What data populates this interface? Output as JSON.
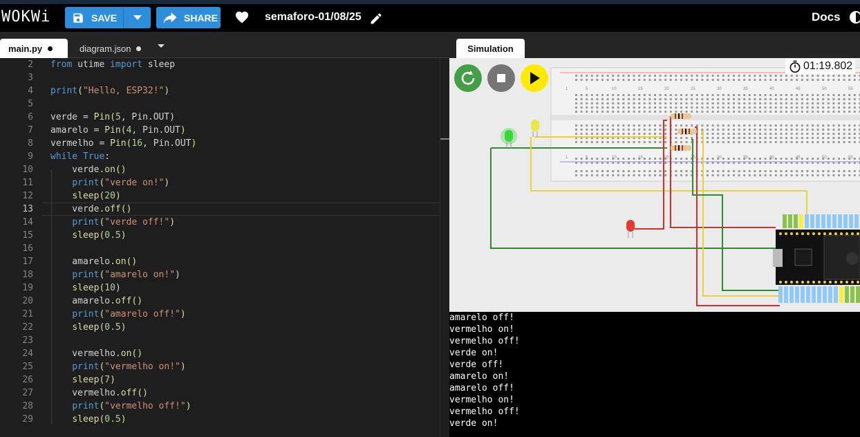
{
  "header": {
    "logo": "WOKWi",
    "save_label": "SAVE",
    "share_label": "SHARE",
    "project_name": "semaforo-01/08/25",
    "docs_label": "Docs"
  },
  "editor": {
    "tabs": [
      {
        "label": "main.py",
        "active": true
      },
      {
        "label": "diagram.json",
        "active": false
      }
    ],
    "current_line": 13,
    "lines": [
      {
        "n": "2",
        "text": "from utime import sleep"
      },
      {
        "n": "3",
        "text": ""
      },
      {
        "n": "4",
        "text": "print(\"Hello, ESP32!\")"
      },
      {
        "n": "5",
        "text": ""
      },
      {
        "n": "6",
        "text": "verde = Pin(5, Pin.OUT)"
      },
      {
        "n": "7",
        "text": "amarelo = Pin(4, Pin.OUT)"
      },
      {
        "n": "8",
        "text": "vermelho = Pin(16, Pin.OUT)"
      },
      {
        "n": "9",
        "text": "while True:"
      },
      {
        "n": "10",
        "text": "    verde.on()"
      },
      {
        "n": "11",
        "text": "    print(\"verde on!\")"
      },
      {
        "n": "12",
        "text": "    sleep(20)"
      },
      {
        "n": "13",
        "text": "    verde.off()"
      },
      {
        "n": "14",
        "text": "    print(\"verde off!\")"
      },
      {
        "n": "15",
        "text": "    sleep(0.5)"
      },
      {
        "n": "16",
        "text": ""
      },
      {
        "n": "17",
        "text": "    amarelo.on()"
      },
      {
        "n": "18",
        "text": "    print(\"amarelo on!\")"
      },
      {
        "n": "19",
        "text": "    sleep(10)"
      },
      {
        "n": "20",
        "text": "    amarelo.off()"
      },
      {
        "n": "21",
        "text": "    print(\"amarelo off!\")"
      },
      {
        "n": "22",
        "text": "    sleep(0.5)"
      },
      {
        "n": "23",
        "text": ""
      },
      {
        "n": "24",
        "text": "    vermelho.on()"
      },
      {
        "n": "25",
        "text": "    print(\"vermelho on!\")"
      },
      {
        "n": "26",
        "text": "    sleep(7)"
      },
      {
        "n": "27",
        "text": "    vermelho.off()"
      },
      {
        "n": "28",
        "text": "    print(\"vermelho off!\")"
      },
      {
        "n": "29",
        "text": "    sleep(0.5)"
      }
    ]
  },
  "simulation": {
    "tab_label": "Simulation",
    "timer": "01:19.802",
    "colors": {
      "restart": "#43a047",
      "stop": "#757575",
      "play": "#ffea00",
      "led_green": "#39d839",
      "led_yellow": "#e8e84a",
      "led_red": "#e53935"
    },
    "breadboard_numbers": [
      "1",
      "5",
      "10",
      "15",
      "20",
      "25",
      "30",
      "35",
      "40",
      "45",
      "50",
      "55"
    ]
  },
  "console": {
    "lines": [
      "amarelo off!",
      "vermelho on!",
      "vermelho off!",
      "verde on!",
      "verde off!",
      "amarelo on!",
      "amarelo off!",
      "vermelho on!",
      "vermelho off!",
      "verde on!"
    ]
  }
}
